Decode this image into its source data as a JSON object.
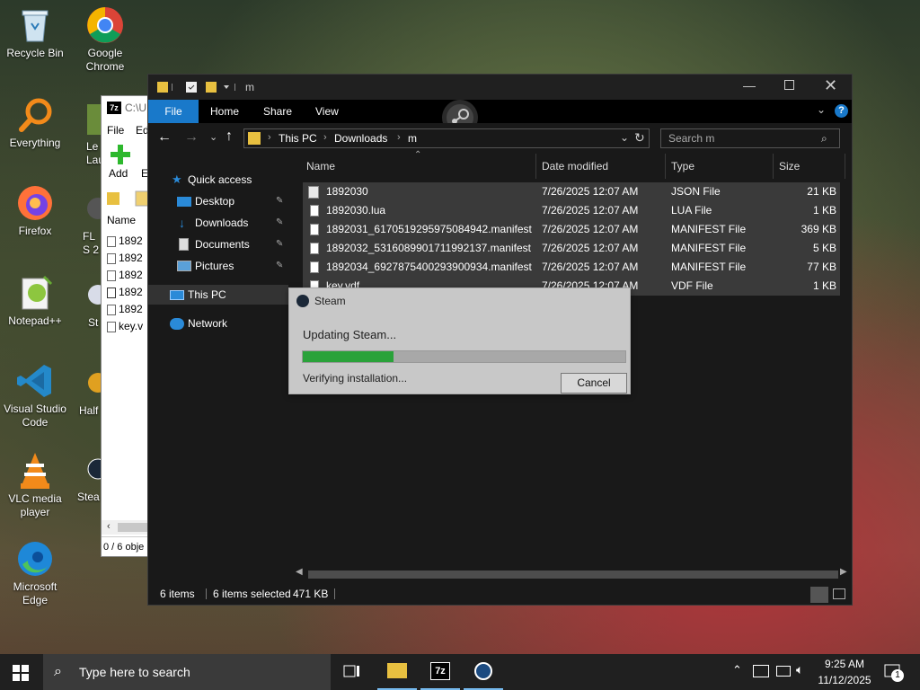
{
  "desktop": {
    "icons": [
      {
        "label": "Recycle Bin"
      },
      {
        "label": "Google Chrome"
      },
      {
        "label": "Everything"
      },
      {
        "label": "Firefox"
      },
      {
        "label": "Notepad++"
      },
      {
        "label": "Visual Studio Code"
      },
      {
        "label": "VLC media player"
      },
      {
        "label": "Microsoft Edge"
      },
      {
        "label": "Le Lau"
      },
      {
        "label": "FL S 2"
      },
      {
        "label": "St"
      },
      {
        "label": "Half"
      },
      {
        "label": "Stea"
      }
    ]
  },
  "sevenzip": {
    "title": "C:\\U",
    "menu": [
      "File",
      "Ed"
    ],
    "add_label": "Add",
    "extract_label": "E",
    "col_name": "Name",
    "rows": [
      "1892",
      "1892",
      "1892",
      "1892",
      "1892",
      "key.v"
    ],
    "status": "0 / 6 obje"
  },
  "explorer": {
    "title": "m",
    "ribbon_tabs": [
      "File",
      "Home",
      "Share",
      "View"
    ],
    "breadcrumb": [
      "This PC",
      "Downloads",
      "m"
    ],
    "search_placeholder": "Search m",
    "nav": {
      "quick_access": "Quick access",
      "items": [
        {
          "label": "Desktop"
        },
        {
          "label": "Downloads"
        },
        {
          "label": "Documents"
        },
        {
          "label": "Pictures"
        }
      ],
      "this_pc": "This PC",
      "network": "Network"
    },
    "columns": {
      "name": "Name",
      "date": "Date modified",
      "type": "Type",
      "size": "Size"
    },
    "files": [
      {
        "name": "1892030",
        "date": "7/26/2025 12:07 AM",
        "type": "JSON File",
        "size": "21 KB"
      },
      {
        "name": "1892030.lua",
        "date": "7/26/2025 12:07 AM",
        "type": "LUA File",
        "size": "1 KB"
      },
      {
        "name": "1892031_6170519295975084942.manifest",
        "date": "7/26/2025 12:07 AM",
        "type": "MANIFEST File",
        "size": "369 KB"
      },
      {
        "name": "1892032_5316089901711992137.manifest",
        "date": "7/26/2025 12:07 AM",
        "type": "MANIFEST File",
        "size": "5 KB"
      },
      {
        "name": "1892034_6927875400293900934.manifest",
        "date": "7/26/2025 12:07 AM",
        "type": "MANIFEST File",
        "size": "77 KB"
      },
      {
        "name": "key.vdf",
        "date": "7/26/2025 12:07 AM",
        "type": "VDF File",
        "size": "1 KB"
      }
    ],
    "status": {
      "items": "6 items",
      "selected": "6 items selected",
      "size": "471 KB"
    }
  },
  "steam_dialog": {
    "title": "Steam",
    "message": "Updating Steam...",
    "progress": 0.28,
    "substatus": "Verifying installation...",
    "cancel_label": "Cancel"
  },
  "taskbar": {
    "search_placeholder": "Type here to search",
    "time": "9:25 AM",
    "date": "11/12/2025",
    "notification_count": "1"
  }
}
